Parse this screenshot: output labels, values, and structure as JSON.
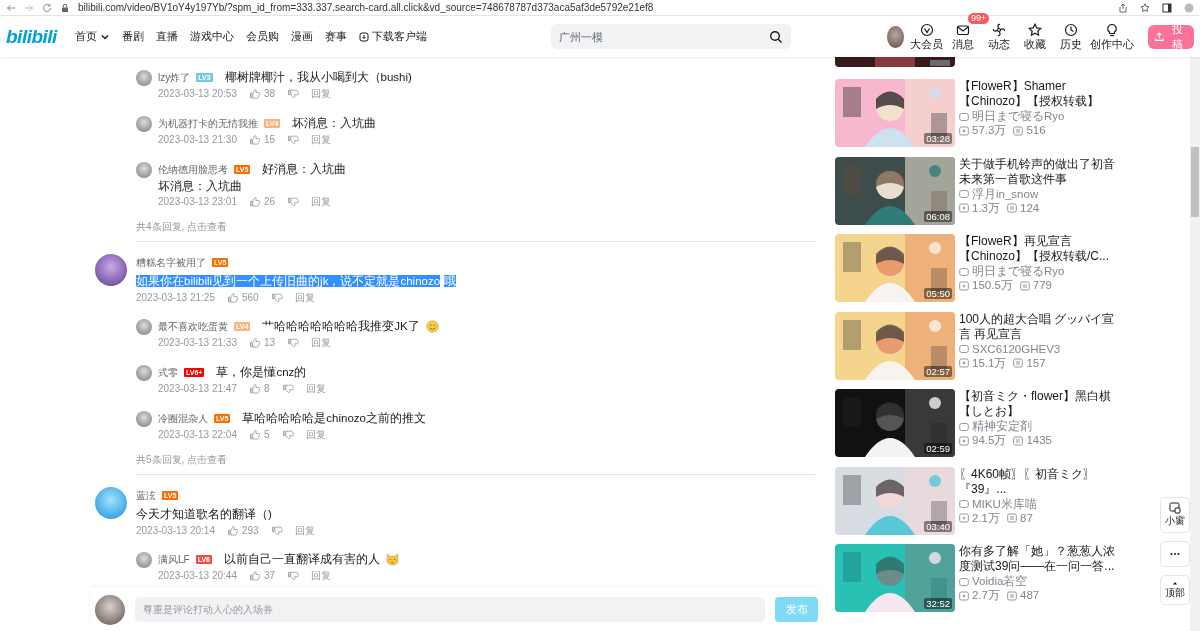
{
  "browser": {
    "url": "bilibili.com/video/BV1oY4y197Yb/?spm_id_from=333.337.search-card.all.click&vd_source=748678787d373aca5af3de5792e21ef8"
  },
  "header": {
    "logo": "bilibili",
    "nav": [
      {
        "label": "首页",
        "kind": "dropdown"
      },
      {
        "label": "番剧",
        "kind": "plain"
      },
      {
        "label": "直播",
        "kind": "plain"
      },
      {
        "label": "游戏中心",
        "kind": "plain"
      },
      {
        "label": "会员购",
        "kind": "plain"
      },
      {
        "label": "漫画",
        "kind": "plain"
      },
      {
        "label": "赛事",
        "kind": "plain"
      },
      {
        "label": "下载客户端",
        "kind": "download"
      }
    ],
    "search": {
      "placeholder": "广州一模"
    },
    "actions": [
      {
        "label": "大会员",
        "kind": "vip"
      },
      {
        "label": "消息",
        "kind": "mail",
        "badge": "99+"
      },
      {
        "label": "动态",
        "kind": "fan"
      },
      {
        "label": "收藏",
        "kind": "star"
      },
      {
        "label": "历史",
        "kind": "clock"
      },
      {
        "label": "创作中心",
        "kind": "bulb"
      }
    ],
    "upload_button": "投稿"
  },
  "threads": [
    {
      "replies": [
        {
          "author": "lzy炸了",
          "badge": "LV3",
          "color": "#73c9e5",
          "text": "椰树牌椰汁，我从小喝到大（bushi)",
          "time": "2023-03-13 20:53",
          "likes": "38",
          "reply_label": "回复"
        },
        {
          "author": "为机器打卡的无情我推",
          "badge": "LV4",
          "color": "#ffb37c",
          "text": "坏消息：入坑曲",
          "time": "2023-03-13 21:30",
          "likes": "15",
          "reply_label": "回复"
        },
        {
          "author": "伦纳德用脸思考",
          "badge": "LV5",
          "color": "#ff6c00",
          "text": "好消息：入坑曲",
          "text_line2": "坏消息：入坑曲",
          "time": "2023-03-13 23:01",
          "likes": "26",
          "reply_label": "回复"
        }
      ],
      "more": "共4条回复, 点击查看"
    },
    {
      "author": "糟糕名字被用了",
      "badge": "LV5",
      "color": "#ff6c00",
      "text": "如果你在bilibili见到一个上传旧曲的jk，说不定就是chinozo",
      "text_after": "哦",
      "highlighted": true,
      "time": "2023-03-13 21:25",
      "likes": "560",
      "reply_label": "回复",
      "replies": [
        {
          "author": "最不喜欢吃蛋黄",
          "badge": "LV4",
          "color": "#ffb37c",
          "text": "艹哈哈哈哈哈哈哈我推变JK了",
          "kind": "smile",
          "time": "2023-03-13 21:33",
          "likes": "13",
          "reply_label": "回复"
        },
        {
          "author": "式零",
          "badge": "LV6+",
          "color": "#ff0000",
          "text": "草，你是懂cnz的",
          "time": "2023-03-13 21:47",
          "likes": "8",
          "reply_label": "回复"
        },
        {
          "author": "冷圈混杂人",
          "badge": "LV5",
          "color": "#ff6c00",
          "text": "草哈哈哈哈哈是chinozo之前的推文",
          "time": "2023-03-13 22:04",
          "likes": "5",
          "reply_label": "回复"
        }
      ],
      "more": "共5条回复, 点击查看"
    },
    {
      "author": "蓝泫",
      "badge": "LV5",
      "color": "#ff6c00",
      "text": "今天才知道歌名的翻译（)",
      "highlighted": false,
      "time": "2023-03-13 20:14",
      "likes": "293",
      "reply_label": "回复",
      "replies": [
        {
          "author": "满风LF",
          "badge": "LV6",
          "color": "#f04c49",
          "text": "以前自己一直翻译成有害的人",
          "kind": "cat",
          "time": "2023-03-13 20:44",
          "likes": "37",
          "reply_label": "回复"
        }
      ]
    }
  ],
  "videos": [
    {
      "title": "【FloweR】Shamer【Chinozo】【授权转载】",
      "up": "明日まで寝るRyo",
      "views": "57.3万",
      "comments": "516",
      "duration": "03:28"
    },
    {
      "title": "关于做手机铃声的做出了初音未来第一首歌这件事",
      "up": "浮月in_snow",
      "views": "1.3万",
      "comments": "124",
      "duration": "06:08"
    },
    {
      "title": "【FloweR】再见宣言【Chinozo】【授权转载/C...",
      "up": "明日まで寝るRyo",
      "views": "150.5万",
      "comments": "779",
      "duration": "05:50"
    },
    {
      "title": "100人的超大合唱 グッバイ宣言 再见宣言",
      "up": "SXC6120GHEV3",
      "views": "15.1万",
      "comments": "157",
      "duration": "02:57"
    },
    {
      "title": "【初音ミク・flower】黑白棋【しとお】",
      "up": "精神安定剤",
      "views": "94.5万",
      "comments": "1435",
      "duration": "02:59"
    },
    {
      "title": "〖4K60帧〗〖初音ミク〗『39』...",
      "up": "MIKU米库喵",
      "views": "2.1万",
      "comments": "87",
      "duration": "03:40"
    },
    {
      "title": "你有多了解「她」？葱葱人浓度测试39问——在一问一答...",
      "up": "Voidia若空",
      "views": "2.7万",
      "comments": "487",
      "duration": "32:52"
    }
  ],
  "float_buttons": [
    {
      "kind": "mini",
      "label": "小窗"
    },
    {
      "kind": "more"
    },
    {
      "kind": "top",
      "label": "顶部"
    }
  ],
  "composer": {
    "placeholder": "尊重是评论打动人心的入场券",
    "button": "发布"
  }
}
